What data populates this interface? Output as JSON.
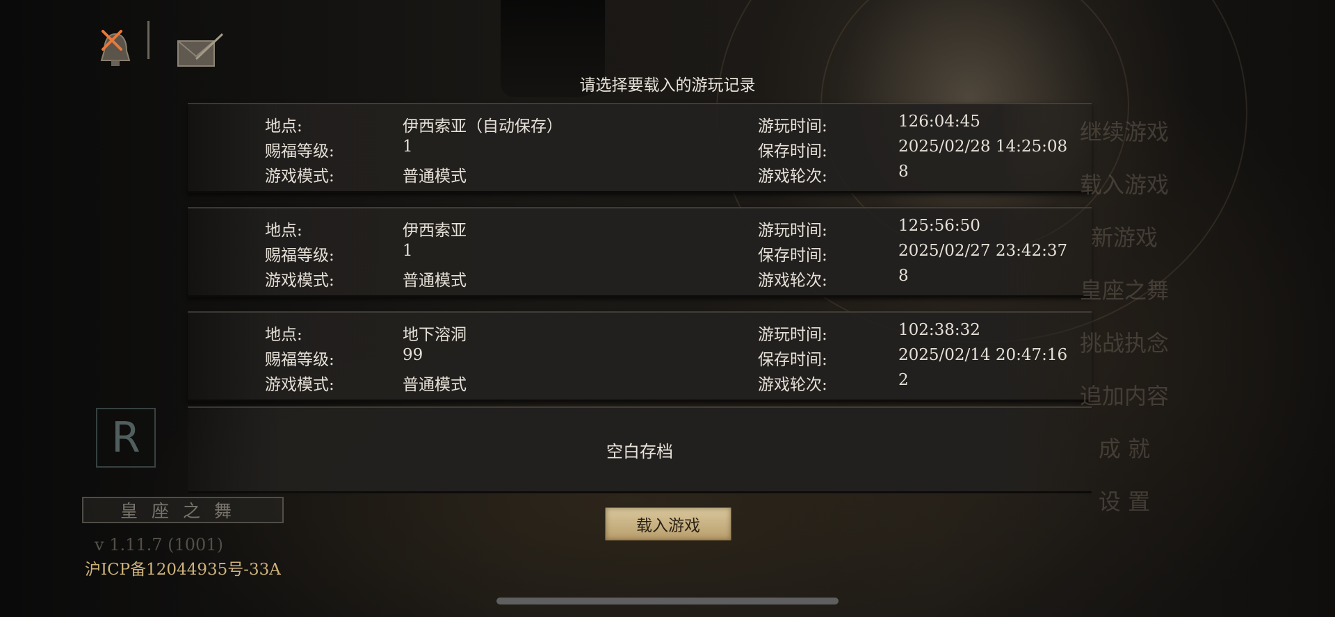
{
  "dialog": {
    "title": "请选择要载入的游玩记录",
    "labels": {
      "location": "地点:",
      "level": "赐福等级:",
      "mode": "游戏模式:",
      "playtime": "游玩时间:",
      "savetime": "保存时间:",
      "cycle": "游戏轮次:"
    },
    "saves": [
      {
        "location": "伊西索亚（自动保存）",
        "level": "1",
        "mode": "普通模式",
        "playtime": "126:04:45",
        "savetime": "2025/02/28 14:25:08",
        "cycle": "8"
      },
      {
        "location": "伊西索亚",
        "level": "1",
        "mode": "普通模式",
        "playtime": "125:56:50",
        "savetime": "2025/02/27 23:42:37",
        "cycle": "8"
      },
      {
        "location": "地下溶洞",
        "level": "99",
        "mode": "普通模式",
        "playtime": "102:38:32",
        "savetime": "2025/02/14 20:47:16",
        "cycle": "2"
      }
    ],
    "empty_slot": "空白存档",
    "load_button": "载入游戏"
  },
  "menu": {
    "items": [
      "继续游戏",
      "载入游戏",
      "新游戏",
      "皇座之舞",
      "挑战执念",
      "追加内容",
      "成 就",
      "设 置"
    ]
  },
  "branding": {
    "logo": "R",
    "banner": "皇座之舞",
    "version": "v 1.11.7 (1001)",
    "icp": "沪ICP备12044935号-33A"
  },
  "icons": {
    "bell": "bell-icon",
    "close_mark": "close-icon",
    "mail": "mail-icon"
  },
  "colors": {
    "button_gold": "#c9b283",
    "icp_gold": "#cdb27c",
    "close_orange": "#e8793a"
  }
}
